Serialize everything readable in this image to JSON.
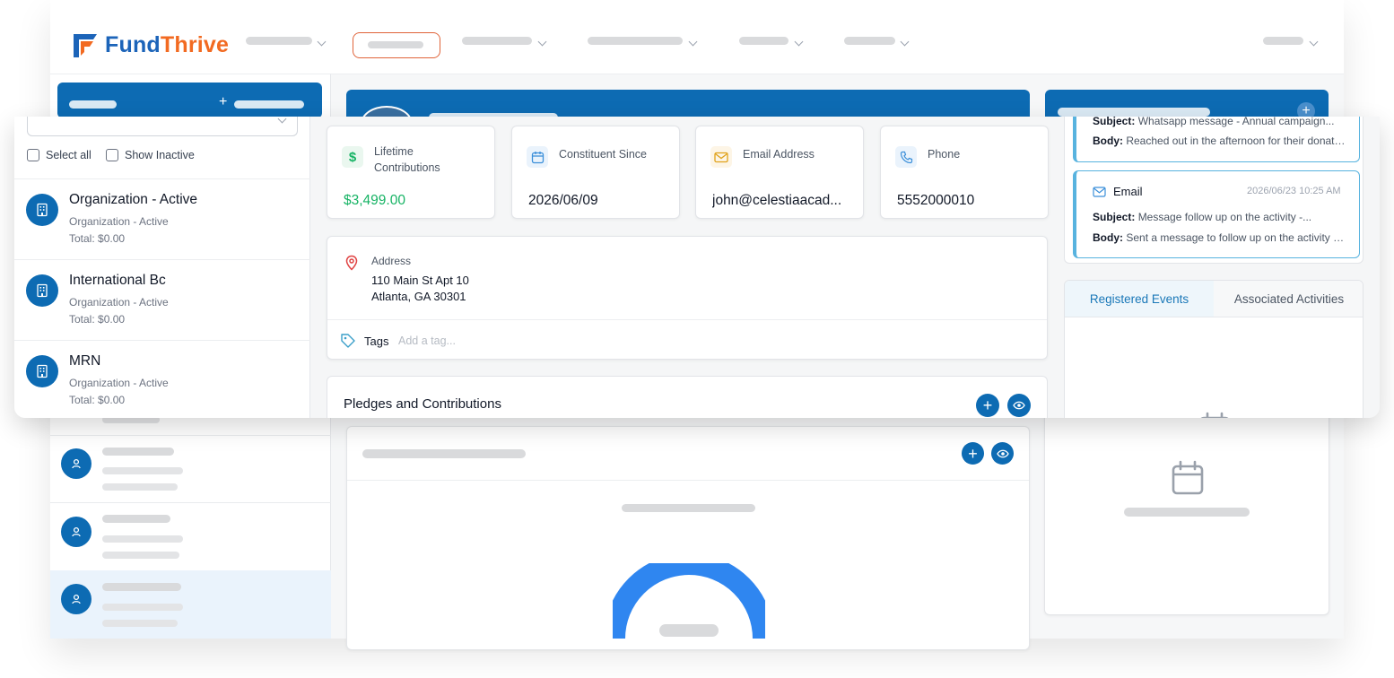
{
  "brand": {
    "name_part1": "Fund",
    "name_part2": "Thrive",
    "colors": {
      "primary_blue": "#0d6bb3",
      "brand_orange": "#f26a21",
      "green": "#16b364",
      "light_blue_border": "#58b3df"
    }
  },
  "sidebar": {
    "select_all_label": "Select all",
    "show_inactive_label": "Show Inactive",
    "organizations": [
      {
        "name": "Organization - Active",
        "status": "Organization - Active",
        "total": "Total: $0.00",
        "icon": "building-icon"
      },
      {
        "name": "International Bc",
        "status": "Organization - Active",
        "total": "Total: $0.00",
        "icon": "building-icon"
      },
      {
        "name": "MRN",
        "status": "Organization - Active",
        "total": "Total: $0.00",
        "icon": "building-icon"
      }
    ]
  },
  "stats": {
    "lifetime": {
      "label": "Lifetime Contributions",
      "value": "$3,499.00",
      "icon": "dollar-icon"
    },
    "since": {
      "label": "Constituent Since",
      "value": "2026/06/09",
      "icon": "calendar-icon"
    },
    "email": {
      "label": "Email Address",
      "value": "john@celestiaacad...",
      "icon": "mail-icon"
    },
    "phone": {
      "label": "Phone",
      "value": "5552000010",
      "icon": "phone-icon"
    }
  },
  "address": {
    "label": "Address",
    "line1": "110 Main St Apt 10",
    "line2": "Atlanta, GA 30301",
    "icon": "map-pin-icon"
  },
  "tags": {
    "label": "Tags",
    "placeholder": "Add a tag...",
    "icon": "tag-icon"
  },
  "pledges": {
    "title": "Pledges and Contributions"
  },
  "activities": [
    {
      "subject_label": "Subject:",
      "subject": "Whatsapp message - Annual campaign...",
      "body_label": "Body:",
      "body": "Reached out in the afternoon for their donati..."
    },
    {
      "type": "Email",
      "timestamp": "2026/06/23 10:25 AM",
      "subject_label": "Subject:",
      "subject": "Message follow up on the activity -...",
      "body_label": "Body:",
      "body": "Sent a message to follow up on the activity -..."
    }
  ],
  "tabs": [
    {
      "label": "Registered Events",
      "active": true
    },
    {
      "label": "Associated Activities",
      "active": false
    }
  ]
}
